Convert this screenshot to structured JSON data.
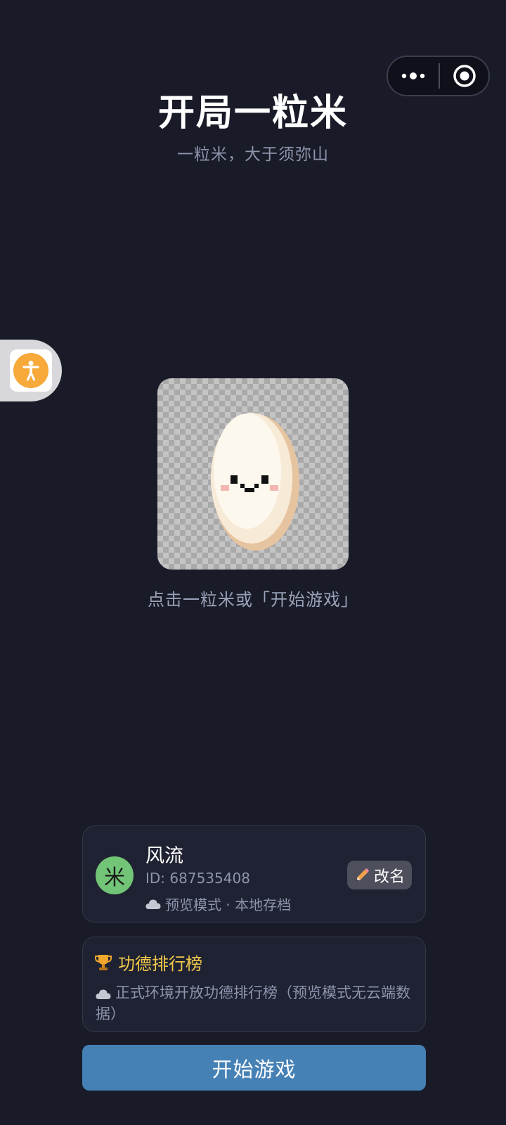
{
  "header": {
    "title": "开局一粒米",
    "subtitle": "一粒米，大于须弥山"
  },
  "capsule": {
    "more_icon": "more-dots-icon",
    "close_icon": "close-miniprogram-icon"
  },
  "accessibility": {
    "icon": "accessibility-person-icon",
    "color": "#f7a93a"
  },
  "main": {
    "hint": "点击一粒米或「开始游戏」"
  },
  "profile": {
    "avatar_char": "米",
    "avatar_color": "#72c476",
    "name": "风流",
    "id_text": "ID: 687535408",
    "mode_text": "预览模式 · 本地存档",
    "rename_label": "改名",
    "rename_icon": "pencil-icon"
  },
  "leaderboard": {
    "icon": "trophy-icon",
    "title": "功德排行榜",
    "description": "正式环境开放功德排行榜（预览模式无云端数据）"
  },
  "start_button": {
    "label": "开始游戏",
    "color": "#4681b6"
  }
}
